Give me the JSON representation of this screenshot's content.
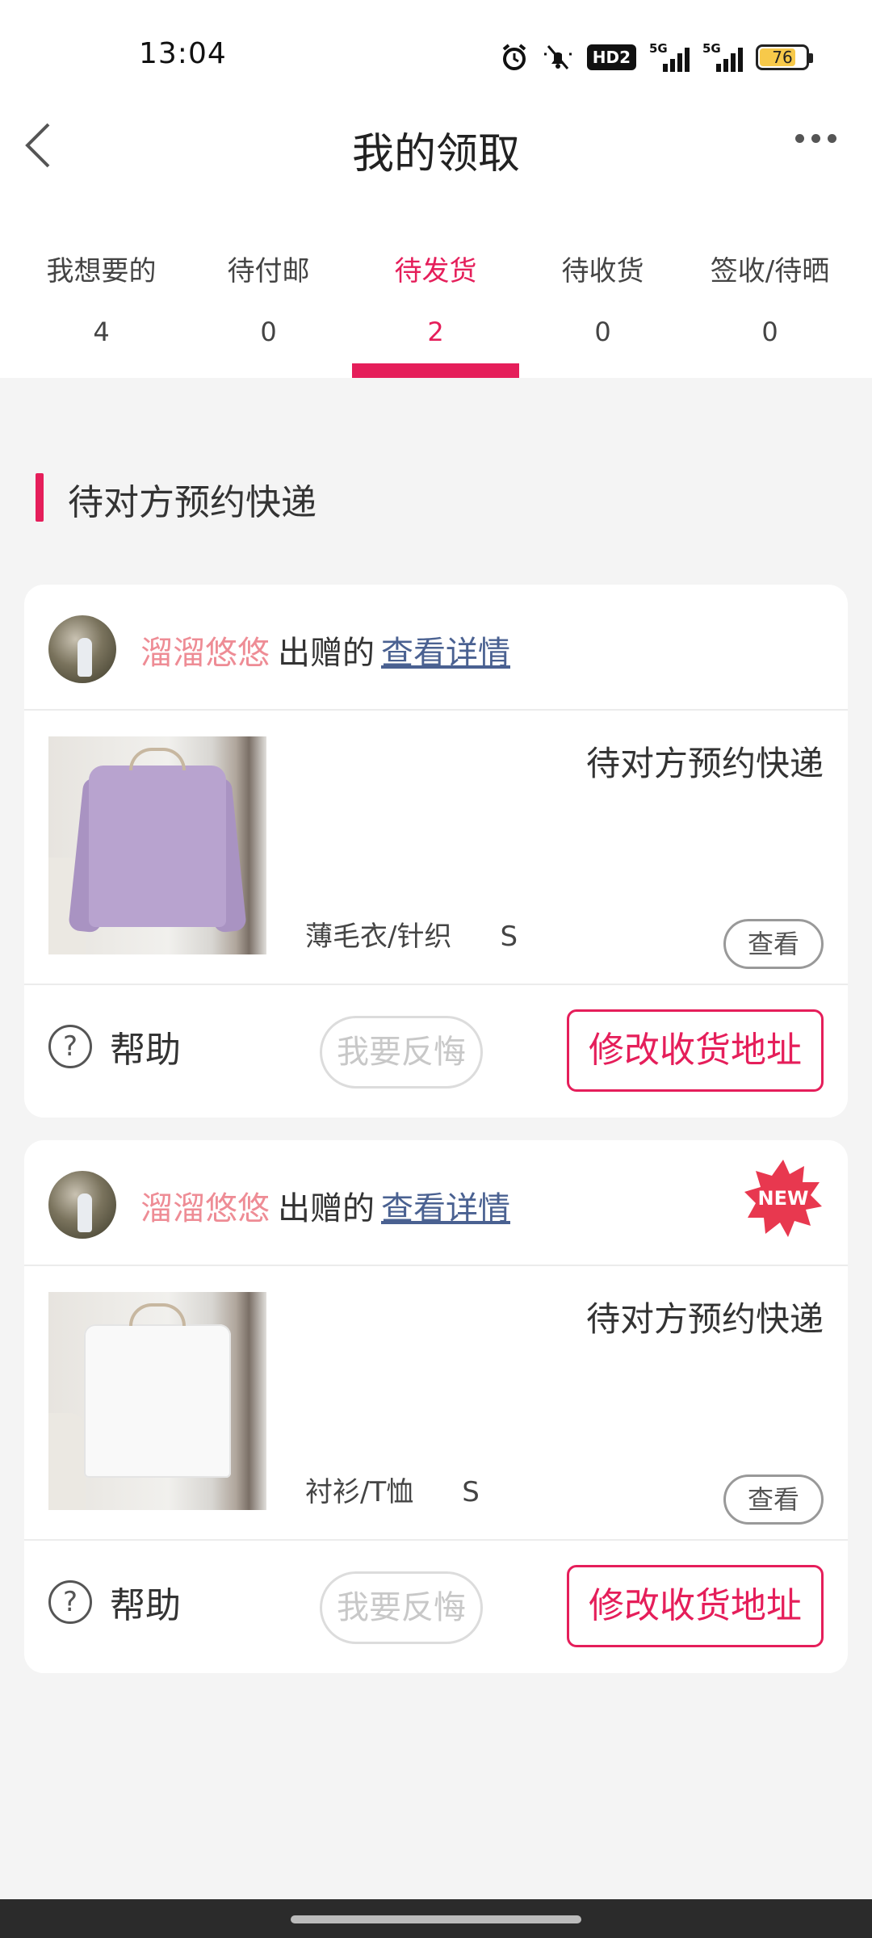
{
  "status_bar": {
    "time": "13:04",
    "signal1_tag": "5G",
    "signal2_tag": "5G",
    "hd_label": "HD2",
    "battery_level": "76",
    "icons": [
      "alarm-icon",
      "mute-icon",
      "hd-icon",
      "signal-icon",
      "signal-icon",
      "battery-icon"
    ]
  },
  "header": {
    "title": "我的领取",
    "back_icon": "back-chevron-icon",
    "more_icon": "more-dots-icon"
  },
  "tabs": [
    {
      "label": "我想要的",
      "count": "4",
      "active": false
    },
    {
      "label": "待付邮",
      "count": "0",
      "active": false
    },
    {
      "label": "待发货",
      "count": "2",
      "active": true
    },
    {
      "label": "待收货",
      "count": "0",
      "active": false
    },
    {
      "label": "签收/待晒",
      "count": "0",
      "active": false
    }
  ],
  "section": {
    "title": "待对方预约快递"
  },
  "cards": [
    {
      "seller": "溜溜悠悠",
      "gift_text": "出赠的",
      "details_link": "查看详情",
      "is_new": false,
      "status": "待对方预约快递",
      "category": "薄毛衣/针织",
      "size": "S",
      "view_label": "查看",
      "help_label": "帮助",
      "regret_label": "我要反悔",
      "modify_label": "修改收货地址"
    },
    {
      "seller": "溜溜悠悠",
      "gift_text": "出赠的",
      "details_link": "查看详情",
      "is_new": true,
      "new_label": "NEW",
      "status": "待对方预约快递",
      "category": "衬衫/T恤",
      "size": "S",
      "view_label": "查看",
      "help_label": "帮助",
      "regret_label": "我要反悔",
      "modify_label": "修改收货地址"
    }
  ],
  "colors": {
    "accent": "#e51e5a",
    "seller": "#ee8c95",
    "link": "#4a6191",
    "background": "#f4f4f4"
  }
}
